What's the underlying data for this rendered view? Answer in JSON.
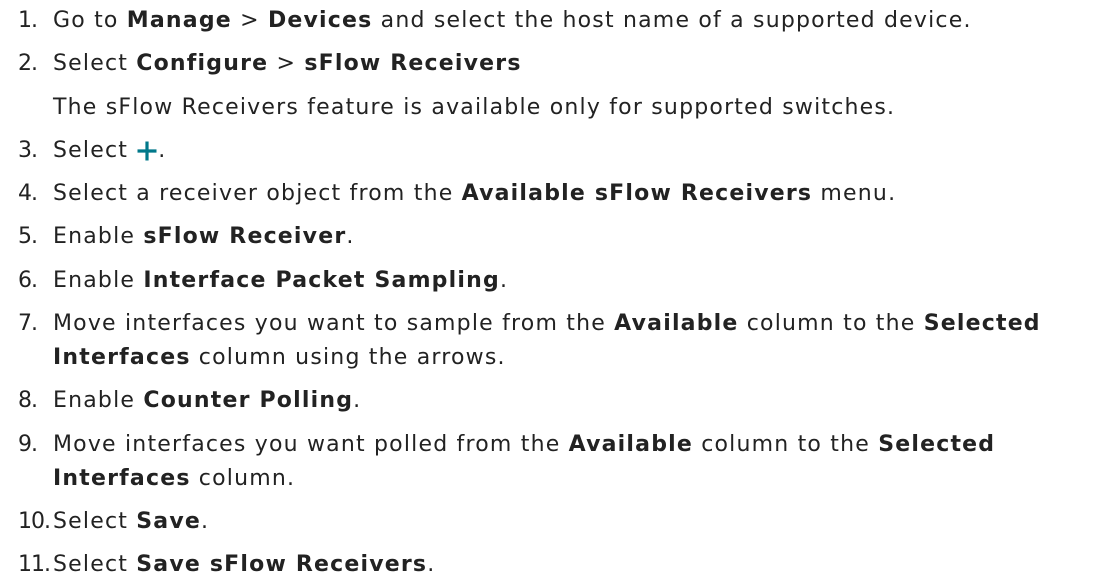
{
  "colors": {
    "text": "#222222",
    "accent": "#00788a"
  },
  "steps": [
    {
      "number": "1.",
      "text": [
        "Go to ",
        "Manage",
        " > ",
        "Devices",
        " and select the host name of a supported device."
      ]
    },
    {
      "number": "2.",
      "text": [
        "Select ",
        "Configure",
        " > ",
        "sFlow Receivers"
      ],
      "note": "The sFlow Receivers feature is available only for supported switches."
    },
    {
      "number": "3.",
      "text": [
        "Select ",
        "."
      ],
      "icon": "plus-icon"
    },
    {
      "number": "4.",
      "text": [
        "Select a receiver object from the ",
        "Available sFlow Receivers",
        " menu."
      ]
    },
    {
      "number": "5.",
      "text": [
        "Enable ",
        "sFlow Receiver",
        "."
      ]
    },
    {
      "number": "6.",
      "text": [
        "Enable ",
        "Interface Packet Sampling",
        "."
      ]
    },
    {
      "number": "7.",
      "text": [
        "Move interfaces you want to sample from the ",
        "Available",
        " column to the ",
        "Selected",
        "Interfaces",
        " column using the arrows."
      ]
    },
    {
      "number": "8.",
      "text": [
        "Enable ",
        "Counter Polling",
        "."
      ]
    },
    {
      "number": "9.",
      "text": [
        "Move interfaces you want polled from the ",
        "Available",
        " column to the ",
        "Selected",
        "Interfaces",
        " column."
      ]
    },
    {
      "number": "10.",
      "text": [
        "Select ",
        "Save",
        "."
      ]
    },
    {
      "number": "11.",
      "text": [
        "Select ",
        "Save sFlow Receivers",
        "."
      ]
    }
  ]
}
